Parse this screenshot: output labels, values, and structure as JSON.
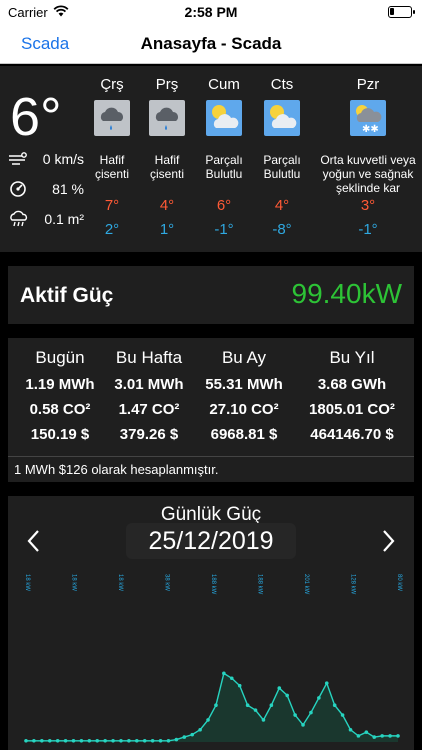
{
  "status": {
    "carrier": "Carrier",
    "time": "2:58 PM"
  },
  "nav": {
    "back": "Scada",
    "title": "Anasayfa - Scada"
  },
  "current": {
    "temp": "6°",
    "wind": "0 km/s",
    "humidity": "81 %",
    "rain": "0.1 m²"
  },
  "forecast": [
    {
      "day": "Çrş",
      "desc": "Hafif çisenti",
      "hi": "7°",
      "lo": "2°",
      "icon": "drizzle-icon"
    },
    {
      "day": "Prş",
      "desc": "Hafif çisenti",
      "hi": "4°",
      "lo": "1°",
      "icon": "drizzle-icon"
    },
    {
      "day": "Cum",
      "desc": "Parçalı Bulutlu",
      "hi": "6°",
      "lo": "-1°",
      "icon": "partly-cloudy-icon"
    },
    {
      "day": "Cts",
      "desc": "Parçalı Bulutlu",
      "hi": "4°",
      "lo": "-8°",
      "icon": "partly-cloudy-icon"
    },
    {
      "day": "Pzr",
      "desc": "Orta kuvvetli veya yoğun ve sağnak şeklinde kar",
      "hi": "3°",
      "lo": "-1°",
      "icon": "snow-showers-icon"
    }
  ],
  "power": {
    "label": "Aktif Güç",
    "value": "99.40kW"
  },
  "energy": {
    "headers": [
      "Bugün",
      "Bu Hafta",
      "Bu Ay",
      "Bu Yıl"
    ],
    "mwh": [
      "1.19 MWh",
      "3.01 MWh",
      "55.31 MWh",
      "3.68 GWh"
    ],
    "co2": [
      "0.58 CO²",
      "1.47 CO²",
      "27.10 CO²",
      "1805.01 CO²"
    ],
    "cost": [
      "150.19 $",
      "379.26 $",
      "6968.81 $",
      "464146.70 $"
    ]
  },
  "note": "1 MWh $126 olarak hesaplanmıştır.",
  "chart": {
    "title": "Günlük Güç",
    "date": "25/12/2019"
  },
  "colors": {
    "accent": "#1a73e8",
    "power": "#2dc336",
    "hi": "#ff5a36",
    "lo": "#2fa8e0",
    "line": "#27d4c0"
  },
  "chart_data": {
    "type": "area",
    "title": "Günlük Güç",
    "tick_labels": [
      "18 kW",
      "18 kW",
      "18 kW",
      "38 kW",
      "188 kW",
      "188 kW",
      "201 kW",
      "128 kW",
      "80 kW"
    ],
    "x": [
      0,
      1,
      2,
      3,
      4,
      5,
      6,
      7,
      8,
      9,
      10,
      11,
      12,
      13,
      14,
      15,
      16,
      17,
      18,
      19,
      20,
      21,
      22,
      23,
      24,
      25,
      26,
      27,
      28,
      29,
      30,
      31,
      32,
      33,
      34,
      35,
      36,
      37,
      38,
      39,
      40,
      41,
      42,
      43,
      44,
      45,
      46,
      47
    ],
    "y": [
      1,
      1,
      1,
      1,
      1,
      1,
      1,
      1,
      1,
      1,
      1,
      1,
      1,
      1,
      1,
      1,
      1,
      1,
      1,
      2,
      4,
      6,
      10,
      18,
      30,
      56,
      52,
      46,
      30,
      26,
      18,
      30,
      44,
      38,
      22,
      14,
      24,
      36,
      48,
      30,
      22,
      10,
      5,
      8,
      4,
      5,
      5,
      5
    ],
    "ylim": [
      0,
      62
    ],
    "grid": false
  }
}
